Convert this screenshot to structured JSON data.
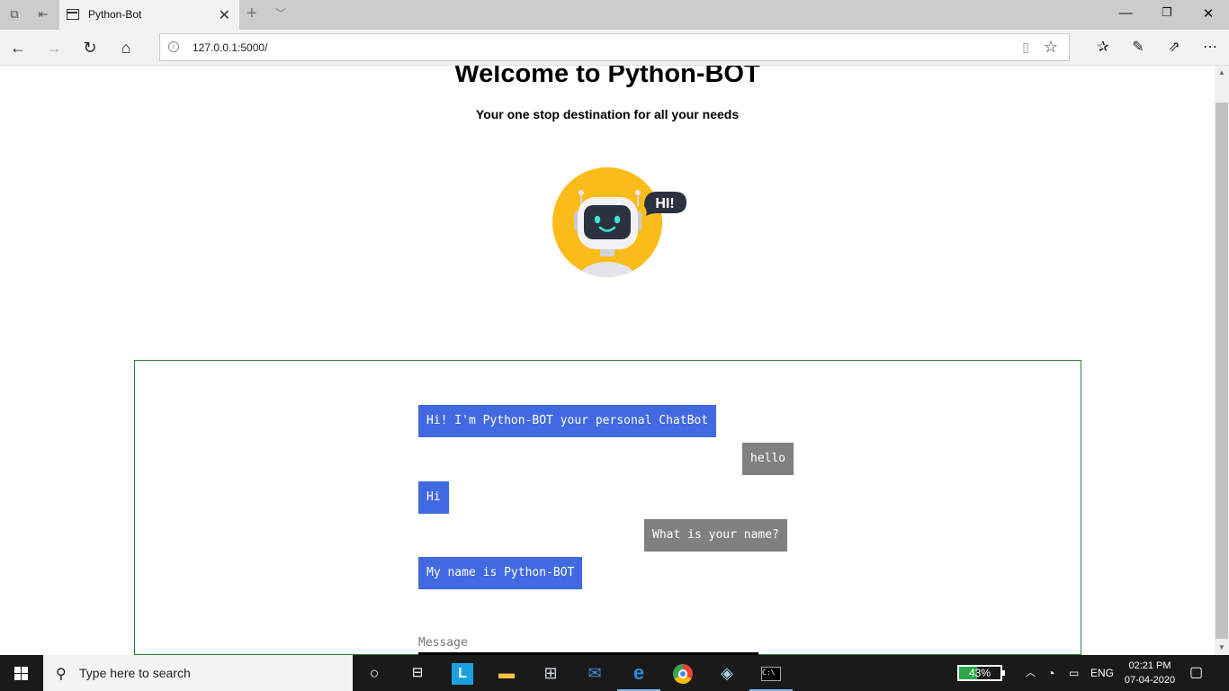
{
  "browser": {
    "tab_title": "Python-Bot",
    "url": "127.0.0.1:5000/"
  },
  "page": {
    "heading": "Welcome to Python-BOT",
    "tagline": "Your one stop destination for all your needs",
    "robot_bubble": "HI!",
    "messages": [
      {
        "sender": "bot",
        "text": "Hi! I'm Python-BOT your personal ChatBot"
      },
      {
        "sender": "user",
        "text": "hello"
      },
      {
        "sender": "bot",
        "text": "Hi"
      },
      {
        "sender": "user",
        "text": "What is your name?"
      },
      {
        "sender": "bot",
        "text": "My name is Python-BOT"
      }
    ],
    "input_placeholder": "Message"
  },
  "taskbar": {
    "search_placeholder": "Type here to search",
    "battery_percent": "43%",
    "battery_level": 0.43,
    "language": "ENG",
    "time": "02:21 PM",
    "date": "07-04-2020"
  },
  "colors": {
    "bot_bubble": "#4169e1",
    "user_bubble": "#808080",
    "chat_border": "#2e7d32"
  }
}
